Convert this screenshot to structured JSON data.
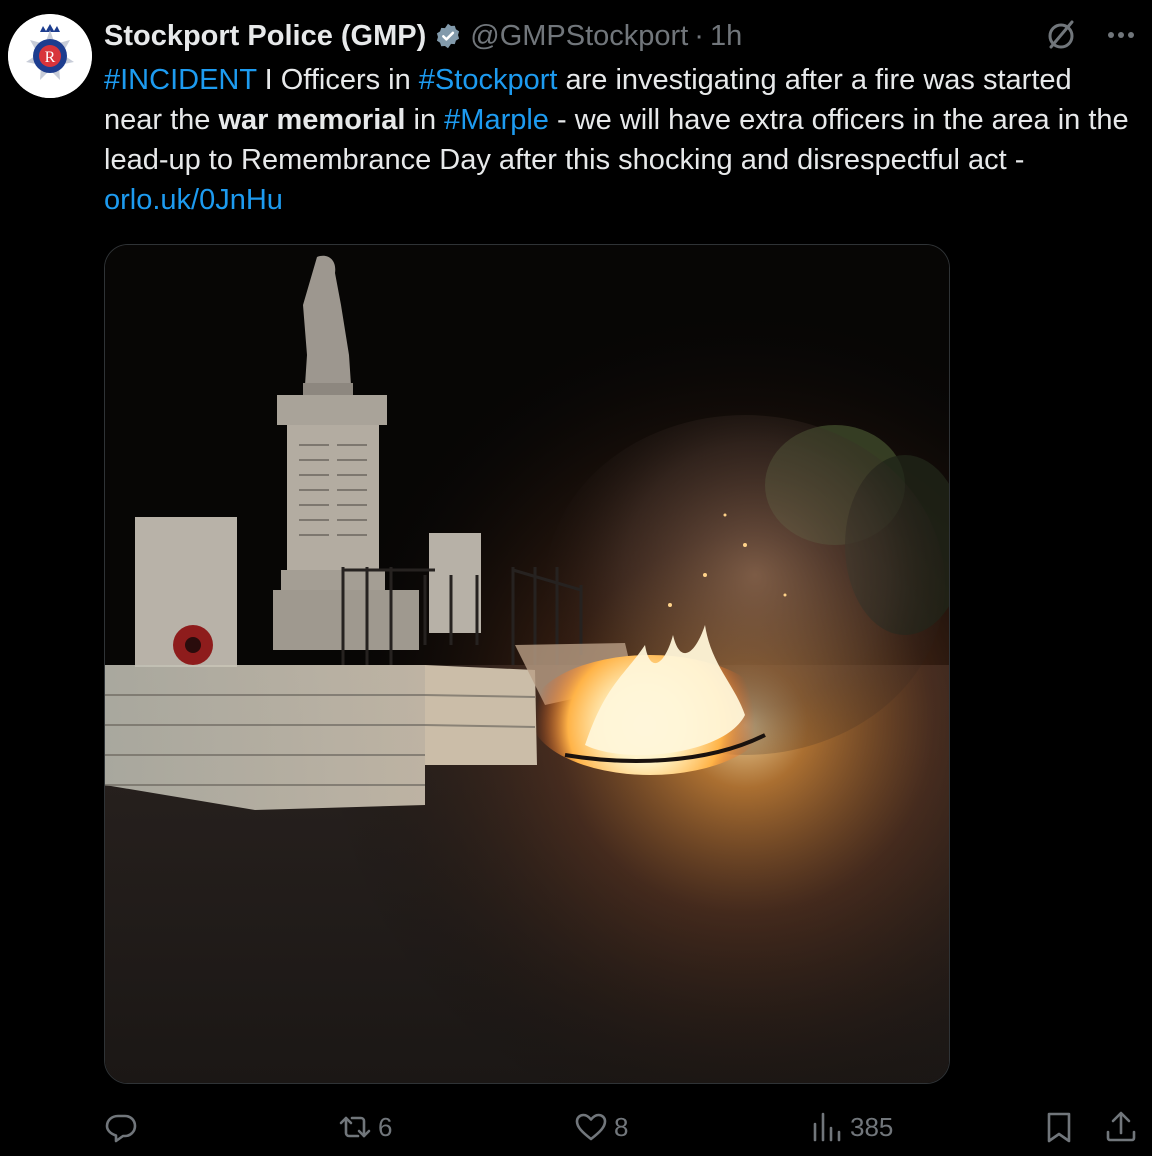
{
  "tweet": {
    "display_name": "Stockport Police (GMP)",
    "handle": "@GMPStockport",
    "separator": "·",
    "time": "1h",
    "text": {
      "p1": "#INCIDENT",
      "p2": " I Officers in ",
      "p3": "#Stockport",
      "p4": " are investigating after a fire was started near the ",
      "p5": "war memorial",
      "p6": " in ",
      "p7": "#Marple",
      "p8": " - we will have extra officers in the area in the lead-up to Remembrance Day after this shocking and disrespectful act - ",
      "p9": "orlo.uk/0JnHu"
    },
    "media_description_icon": "photo-war-memorial-fire",
    "stats": {
      "replies": "",
      "reposts": "6",
      "likes": "8",
      "views": "385"
    }
  },
  "icons": {
    "verified": "verified-badge-icon",
    "grok": "grok-icon",
    "more": "more-icon",
    "reply": "reply-icon",
    "repost": "repost-icon",
    "like": "like-icon",
    "views": "views-icon",
    "bookmark": "bookmark-icon",
    "share": "share-icon"
  },
  "colors": {
    "background": "#000000",
    "text": "#e7e9ea",
    "secondary": "#71767b",
    "link": "#1d9bf0"
  }
}
